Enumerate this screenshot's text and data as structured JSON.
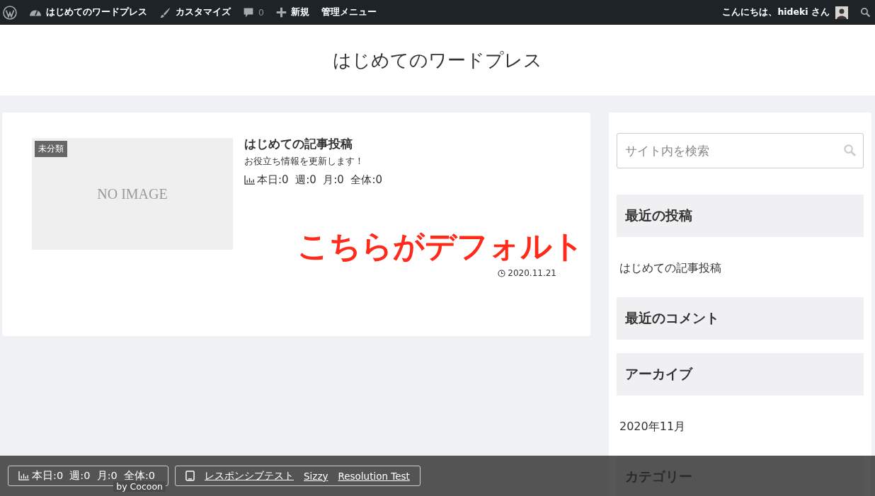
{
  "admin_bar": {
    "items": [
      {
        "kind": "logo"
      },
      {
        "kind": "dashboard",
        "label": "はじめてのワードプレス"
      },
      {
        "kind": "brush",
        "label": "カスタマイズ"
      },
      {
        "kind": "comment",
        "label": "0"
      },
      {
        "kind": "plus",
        "label": "新規"
      },
      {
        "kind": "text",
        "label": "管理メニュー"
      }
    ],
    "greeting": "こんにちは、hideki さん"
  },
  "header": {
    "site_title": "はじめてのワードプレス"
  },
  "post": {
    "category": "未分類",
    "thumbnail_text": "NO IMAGE",
    "title": "はじめての記事投稿",
    "snippet": "お役立ち情報を更新します！",
    "stats": "本日:0  週:0  月:0  全体:0",
    "date": "2020.11.21",
    "annotation": "こちらがデフォルト"
  },
  "sidebar": {
    "search": {
      "placeholder": "サイト内を検索"
    },
    "widgets": [
      {
        "title": "最近の投稿",
        "items": [
          "はじめての記事投稿"
        ]
      },
      {
        "title": "最近のコメント"
      },
      {
        "title": "アーカイブ",
        "items": [
          "2020年11月"
        ]
      },
      {
        "title": "カテゴリー"
      }
    ]
  },
  "bottom_bar": {
    "stats": "本日:0  週:0  月:0  全体:0",
    "credit": "by Cocoon",
    "links": [
      "レスポンシブテスト",
      "Sizzy",
      "Resolution Test"
    ]
  }
}
